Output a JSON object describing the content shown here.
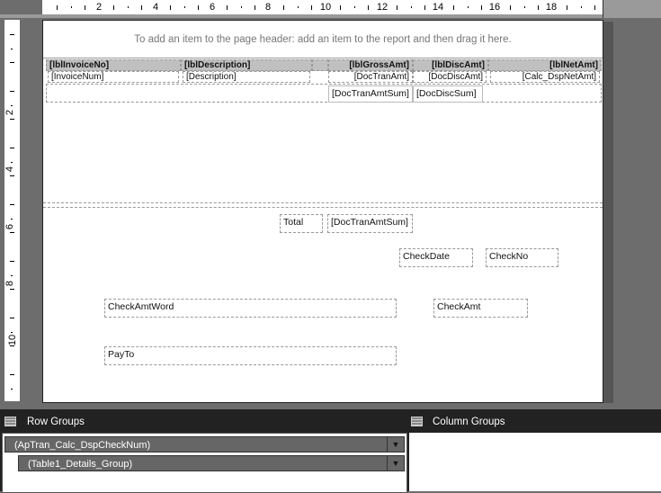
{
  "ruler": {
    "h_labels": [
      "2",
      "4",
      "6",
      "8",
      "10",
      "12",
      "14",
      "16",
      "18"
    ],
    "v_labels": [
      "2",
      "4",
      "6",
      "8",
      "10"
    ]
  },
  "page_header_hint": "To add an item to the page header: add an item to the report and then drag it here.",
  "table": {
    "headers": [
      "[lblInvoiceNo]",
      "[lblDescription]",
      "[lblGrossAmt]",
      "[lblDiscAmt]",
      "[lblNetAmt]"
    ],
    "details": [
      "[InvoiceNum]",
      "[Description]",
      "[DocTranAmt]",
      "[DocDiscAmt]",
      "[Calc_DspNetAmt]"
    ],
    "footer": [
      "[DocTranAmtSum]",
      "[DocDiscSum]"
    ]
  },
  "body_fields": {
    "total_label": "Total",
    "total_value": "[DocTranAmtSum]",
    "check_date": "CheckDate",
    "check_no": "CheckNo",
    "check_amt_word": "CheckAmtWord",
    "check_amt": "CheckAmt",
    "pay_to": "PayTo"
  },
  "groups": {
    "row_title": "Row Groups",
    "column_title": "Column Groups",
    "row_groups": [
      "(ApTran_Calc_DspCheckNum)",
      "(Table1_Details_Group)"
    ]
  }
}
